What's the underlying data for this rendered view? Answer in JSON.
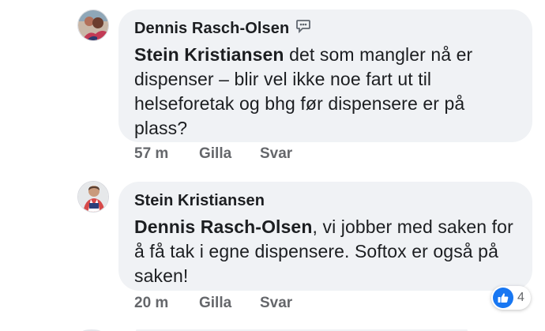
{
  "comments": [
    {
      "author": "Dennis Rasch-Olsen",
      "author_badge_icon": "messenger-chat-icon",
      "mention": "Stein Kristiansen",
      "text": " det som mangler nå er dispenser – blir vel ikke noe fart ut til helseforetak og bhg før dispensere er på plass?",
      "time": "57 m",
      "like_label": "Gilla",
      "reply_label": "Svar"
    },
    {
      "author": "Stein Kristiansen",
      "mention": "Dennis Rasch-Olsen",
      "text": ", vi jobber med saken for å få tak i egne dispensere. Softox er også på saken!",
      "time": "20 m",
      "like_label": "Gilla",
      "reply_label": "Svar",
      "reaction_icon": "thumbs-up-icon",
      "reaction_count": "4"
    }
  ],
  "colors": {
    "bubble": "#f0f2f5",
    "text": "#1c1e21",
    "meta": "#65676b",
    "like_blue": "#1877f2"
  }
}
